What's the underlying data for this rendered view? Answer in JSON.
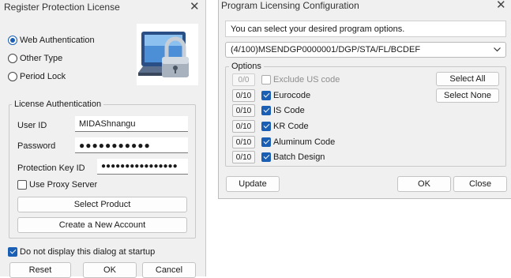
{
  "register_dialog": {
    "title": "Register Protection License",
    "close_glyph": "✕",
    "radio_options": [
      {
        "label": "Web Authentication",
        "selected": true
      },
      {
        "label": "Other Type",
        "selected": false
      },
      {
        "label": "Period Lock",
        "selected": false
      }
    ],
    "license_group": {
      "legend": "License Authentication",
      "user_id_label": "User ID",
      "user_id_value": "MIDAShnangu",
      "password_label": "Password",
      "password_value": "●●●●●●●●●●●",
      "protection_key_label": "Protection Key ID",
      "protection_key_value": "●●●●●●●●●●●●●●●●",
      "proxy_label": "Use Proxy Server",
      "proxy_checked": false,
      "select_product_label": "Select Product",
      "create_account_label": "Create a New Account"
    },
    "startup_checkbox_label": "Do not display this dialog at startup",
    "startup_checked": true,
    "reset_label": "Reset",
    "ok_label": "OK",
    "cancel_label": "Cancel",
    "accent_color": "#1a5fb4"
  },
  "config_dialog": {
    "title": "Program Licensing Configuration",
    "close_glyph": "✕",
    "info_text": "You can select your desired program options.",
    "combo_value": "(4/100)MSENDGP0000001/DGP/STA/FL/BCDEF",
    "options_legend": "Options",
    "options": [
      {
        "count": "0/0",
        "label": "Exclude US code",
        "checked": false,
        "enabled": false
      },
      {
        "count": "0/10",
        "label": "Eurocode",
        "checked": true,
        "enabled": true
      },
      {
        "count": "0/10",
        "label": "IS Code",
        "checked": true,
        "enabled": true
      },
      {
        "count": "0/10",
        "label": "KR Code",
        "checked": true,
        "enabled": true
      },
      {
        "count": "0/10",
        "label": "Aluminum Code",
        "checked": true,
        "enabled": true
      },
      {
        "count": "0/10",
        "label": "Batch Design",
        "checked": true,
        "enabled": true
      }
    ],
    "select_all_label": "Select All",
    "select_none_label": "Select None",
    "update_label": "Update",
    "ok_label": "OK",
    "close_label": "Close"
  }
}
